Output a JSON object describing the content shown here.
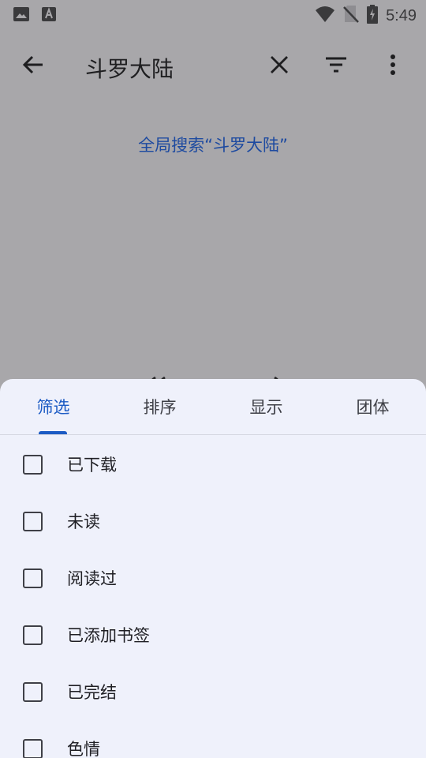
{
  "status_bar": {
    "time": "5:49",
    "left_icons": [
      "image-icon",
      "text-a-icon"
    ],
    "right_icons": [
      "wifi-icon",
      "no-sim-icon",
      "battery-charging-icon"
    ]
  },
  "toolbar": {
    "back_icon": "arrow-back-icon",
    "query": "斗罗大陆",
    "clear_icon": "close-icon",
    "filter_icon": "filter-icon",
    "more_icon": "more-vert-icon"
  },
  "global_search_label": "全局搜索“斗罗大陆”",
  "sheet": {
    "tabs": [
      {
        "label": "筛选",
        "active": true
      },
      {
        "label": "排序",
        "active": false
      },
      {
        "label": "显示",
        "active": false
      },
      {
        "label": "团体",
        "active": false
      }
    ],
    "filters": [
      {
        "label": "已下载",
        "checked": false
      },
      {
        "label": "未读",
        "checked": false
      },
      {
        "label": "阅读过",
        "checked": false
      },
      {
        "label": "已添加书签",
        "checked": false
      },
      {
        "label": "已完结",
        "checked": false
      },
      {
        "label": "色情",
        "checked": false
      }
    ]
  },
  "colors": {
    "scrim": "#a8a7aa",
    "sheet_bg": "#eff1fb",
    "accent": "#1c5bc4",
    "link": "#1d4aa0"
  }
}
